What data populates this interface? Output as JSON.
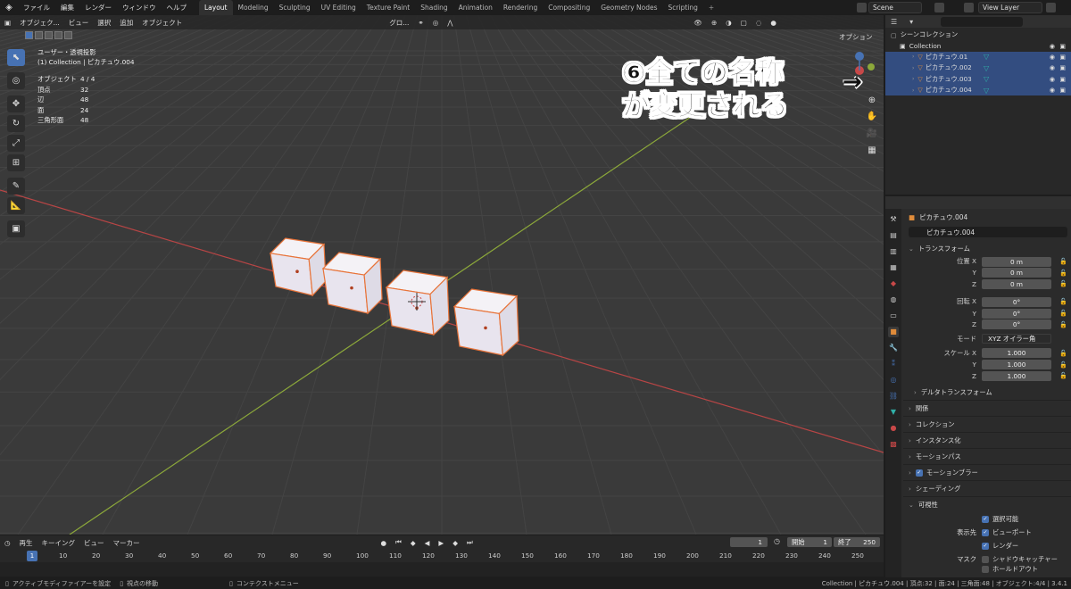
{
  "menubar": {
    "items": [
      "ファイル",
      "編集",
      "レンダー",
      "ウィンドウ",
      "ヘルプ"
    ],
    "workspaces": [
      "Layout",
      "Modeling",
      "Sculpting",
      "UV Editing",
      "Texture Paint",
      "Shading",
      "Animation",
      "Rendering",
      "Compositing",
      "Geometry Nodes",
      "Scripting"
    ],
    "active_workspace": "Layout",
    "scene": "Scene",
    "view_layer": "View Layer"
  },
  "viewport": {
    "header": {
      "mode": "オブジェク...",
      "menus": [
        "ビュー",
        "選択",
        "追加",
        "オブジェクト"
      ],
      "transform": "グロ...",
      "option": "オプション"
    },
    "info_line1": "ユーザー・透視投影",
    "info_line2": "(1) Collection | ピカチュウ.004",
    "stats": [
      {
        "k": "オブジェクト",
        "v": "4 / 4"
      },
      {
        "k": "頂点",
        "v": "32"
      },
      {
        "k": "辺",
        "v": "48"
      },
      {
        "k": "面",
        "v": "24"
      },
      {
        "k": "三角形面",
        "v": "48"
      }
    ],
    "annotation_line1": "⑥全ての名称",
    "annotation_line2": "が変更される",
    "annotation_arrow": "→"
  },
  "outliner": {
    "scene_collection": "シーンコレクション",
    "collection": "Collection",
    "objects": [
      {
        "name": "ピカチュウ.01",
        "selected": true
      },
      {
        "name": "ピカチュウ.002",
        "selected": true
      },
      {
        "name": "ピカチュウ.003",
        "selected": true
      },
      {
        "name": "ピカチュウ.004",
        "selected": true
      }
    ]
  },
  "properties": {
    "object_title": "ピカチュウ.004",
    "object_name": "ピカチュウ.004",
    "transform_panel": "トランスフォーム",
    "location_label": "位置 X",
    "location": [
      "0 m",
      "0 m",
      "0 m"
    ],
    "rotation_label": "回転 X",
    "rotation": [
      "0°",
      "0°",
      "0°"
    ],
    "mode_label": "モード",
    "mode_value": "XYZ オイラー角",
    "scale_label": "スケール X",
    "scale": [
      "1.000",
      "1.000",
      "1.000"
    ],
    "axis_y": "Y",
    "axis_z": "Z",
    "delta": "デルタトランスフォーム",
    "panels": [
      "関係",
      "コレクション",
      "インスタンス化",
      "モーションパス",
      "モーションブラー",
      "シェーディング"
    ],
    "visibility_panel": "可視性",
    "selectable": "選択可能",
    "show_in_label": "表示先",
    "viewport_chk": "ビューポート",
    "render_chk": "レンダー",
    "mask_label": "マスク",
    "shadow_catcher": "シャドウキャッチャー",
    "holdout": "ホールドアウト"
  },
  "timeline": {
    "menus": [
      "再生",
      "キーイング",
      "ビュー",
      "マーカー"
    ],
    "current_frame": "1",
    "start_label": "開始",
    "start": "1",
    "end_label": "終了",
    "end": "250",
    "ruler": [
      "1",
      "10",
      "20",
      "30",
      "40",
      "50",
      "60",
      "70",
      "80",
      "90",
      "100",
      "110",
      "120",
      "130",
      "140",
      "150",
      "160",
      "170",
      "180",
      "190",
      "200",
      "210",
      "220",
      "230",
      "240",
      "250"
    ]
  },
  "statusbar": {
    "left1": "アクティブモディファイアーを設定",
    "left2": "視点の移動",
    "left3": "コンテクストメニュー",
    "right": "Collection | ピカチュウ.004 | 頂点:32 | 面:24 | 三角面:48 | オブジェクト:4/4 | 3.4.1"
  },
  "colors": {
    "accent": "#4772b3",
    "selection_outline": "#e8743a",
    "x_axis": "#c84848",
    "y_axis": "#8ca83a"
  }
}
